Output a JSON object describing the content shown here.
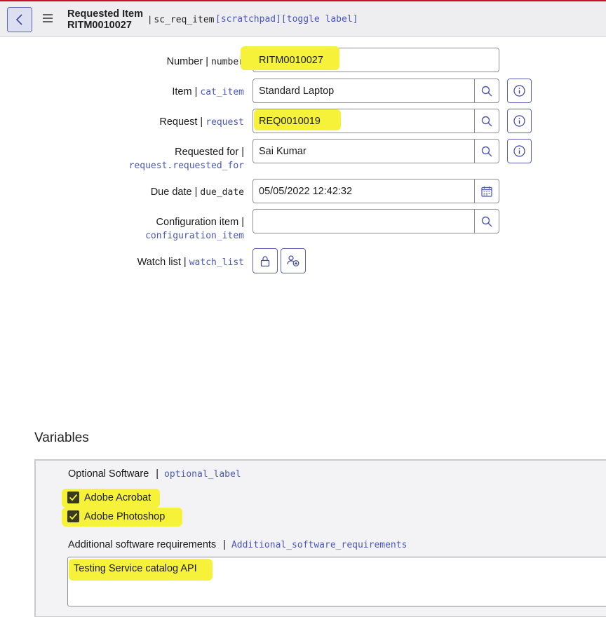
{
  "header": {
    "title": "Requested Item",
    "record_number": "RITM0010027",
    "separator": "|",
    "table_name": "sc_req_item",
    "links": "[scratchpad][toggle label]"
  },
  "form": {
    "number": {
      "label": "Number |",
      "code": "number",
      "value": "RITM0010027"
    },
    "item": {
      "label": "Item |",
      "code": "cat_item",
      "value": "Standard Laptop"
    },
    "request": {
      "label": "Request |",
      "code": "request",
      "value": "REQ0010019"
    },
    "requested_for": {
      "label": "Requested for |",
      "code": "request.requested_for",
      "value": "Sai Kumar"
    },
    "due_date": {
      "label": "Due date |",
      "code": "due_date",
      "value": "05/05/2022 12:42:32"
    },
    "configuration_item": {
      "label": "Configuration item |",
      "code": "configuration_item",
      "value": ""
    },
    "watch_list": {
      "label": "Watch list |",
      "code": "watch_list"
    }
  },
  "variables": {
    "section_title": "Variables",
    "optional_software": {
      "label": "Optional Software",
      "separator": "|",
      "code": "optional_label"
    },
    "options": [
      {
        "label": "Adobe Acrobat",
        "checked": true
      },
      {
        "label": "Adobe Photoshop",
        "checked": true
      }
    ],
    "additional": {
      "label": "Additional software requirements",
      "separator": "|",
      "code": "Additional_software_requirements",
      "value": "Testing Service catalog API"
    }
  },
  "colors": {
    "accent": "#5b63b8",
    "link": "#4a57b8",
    "highlight": "#f6f23a",
    "top_bar": "#c8102e"
  },
  "icons": [
    "chevron-left-icon",
    "hamburger-menu-icon",
    "search-icon",
    "info-icon",
    "calendar-icon",
    "lock-icon",
    "add-user-icon",
    "checkmark-icon"
  ]
}
